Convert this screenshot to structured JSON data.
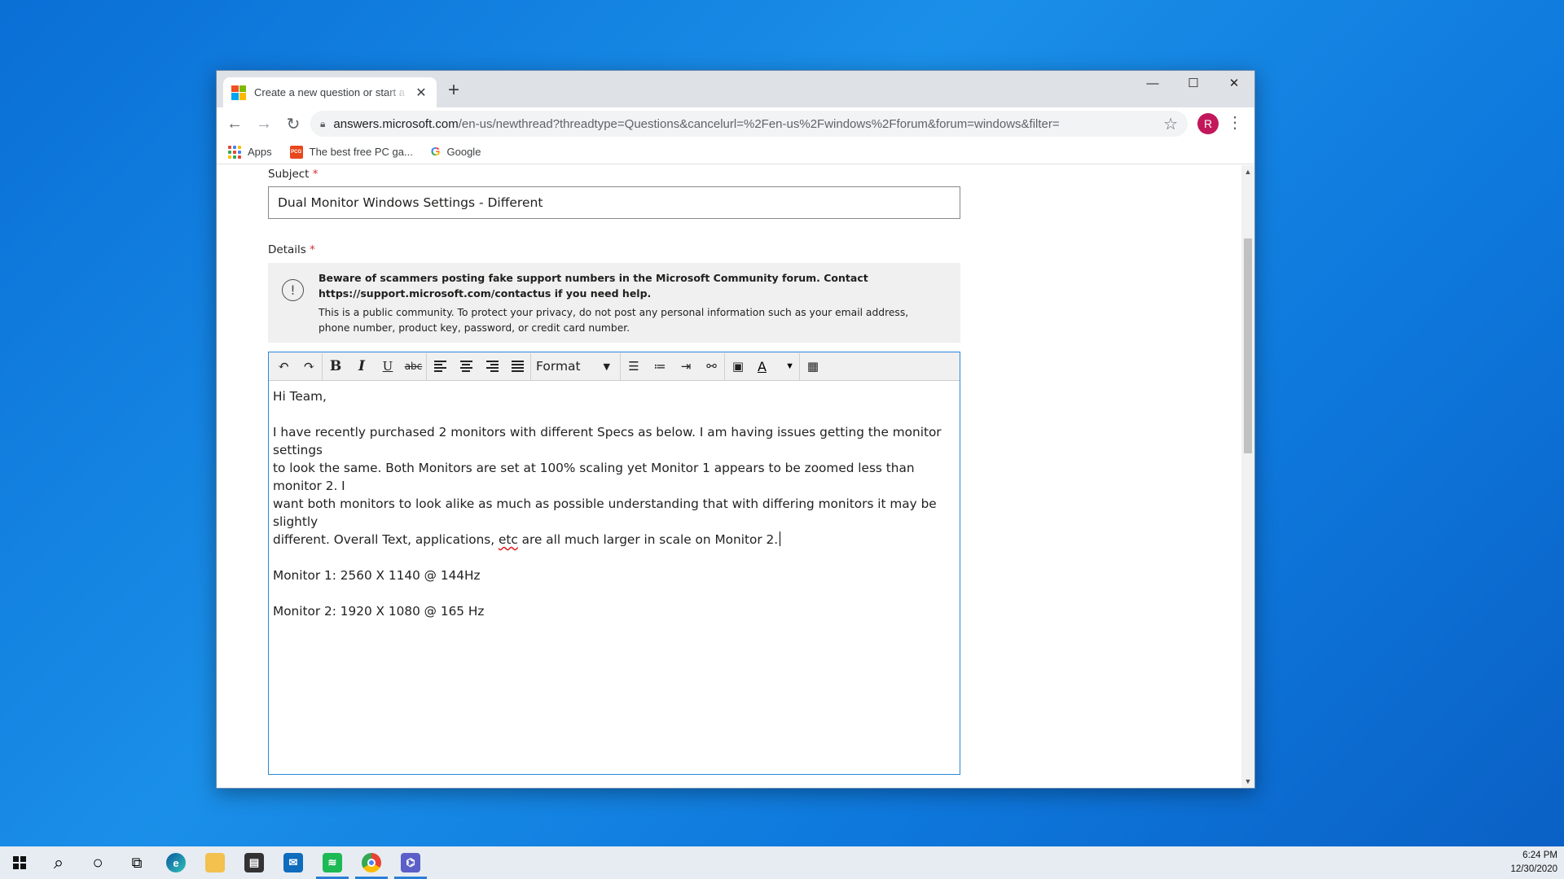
{
  "browser": {
    "tab_title": "Create a new question or start a discussion",
    "tab_close": "✕",
    "new_tab": "+",
    "url_host": "answers.microsoft.com",
    "url_path": "/en-us/newthread?threadtype=Questions&cancelurl=%2Fen-us%2Fwindows%2Fforum&forum=windows&filter=",
    "avatar_letter": "R",
    "bookmarks": [
      {
        "label": "Apps",
        "icon": "apps-grid-icon"
      },
      {
        "label": "The best free PC ga...",
        "icon": "pcgamer-icon",
        "icon_text": "PCG"
      },
      {
        "label": "Google",
        "icon": "google-icon",
        "icon_text": "G"
      }
    ],
    "window_controls": {
      "minimize": "—",
      "maximize": "☐",
      "close": "✕"
    }
  },
  "form": {
    "subject_label": "Subject",
    "required_mark": "*",
    "subject_value": "Dual Monitor Windows Settings - Different",
    "details_label": "Details",
    "notice_bold_1": "Beware of scammers posting fake support numbers in the Microsoft Community forum. Contact",
    "notice_bold_2": "https://support.microsoft.com/contactus if you need help.",
    "notice_text_1": "This is a public community. To protect your privacy, do not post any personal information such as your email address,",
    "notice_text_2": "phone number, product key, password, or credit card number.",
    "notice_icon": "!"
  },
  "editor": {
    "format_label": "Format",
    "toolbar": {
      "undo": "↶",
      "redo": "↷",
      "bold": "B",
      "italic": "I",
      "underline": "U",
      "strike": "abc",
      "font_color": "A"
    },
    "body": {
      "greeting": "Hi Team,",
      "para_1_line_1": "I have recently purchased 2 monitors with different Specs as below. I am having issues getting the monitor settings",
      "para_1_line_2": "to look the same. Both Monitors are set at 100% scaling yet Monitor 1 appears to be zoomed less than monitor 2. I",
      "para_1_line_3": "want both monitors to look alike as much as possible understanding that with differing monitors it may be slightly",
      "para_1_line_4a": "different. Overall Text, applications, ",
      "para_1_line_4_spell": "etc",
      "para_1_line_4b": " are all much larger in scale on Monitor 2.",
      "monitor_1": "Monitor 1: 2560 X 1140 @ 144Hz",
      "monitor_2": "Monitor 2: 1920 X 1080 @ 165 Hz"
    }
  },
  "taskbar": {
    "time": "6:24 PM",
    "date": "12/30/2020",
    "search_icon": "⌕",
    "cortana_icon": "○"
  },
  "colors": {
    "desktop": "#0a6fd6",
    "accent": "#2b88d8",
    "required": "#d13438",
    "avatar": "#c2185b"
  }
}
